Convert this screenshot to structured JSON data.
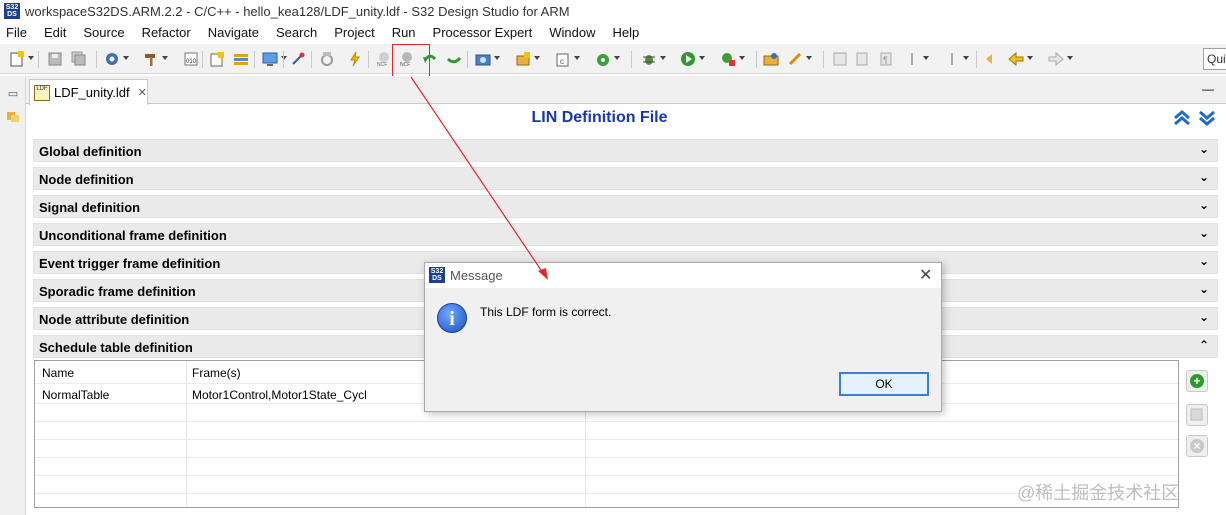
{
  "window": {
    "title": "workspaceS32DS.ARM.2.2 - C/C++ - hello_kea128/LDF_unity.ldf - S32 Design Studio for ARM",
    "app_icon_text_1": "S32",
    "app_icon_text_2": "DS"
  },
  "menu": [
    "File",
    "Edit",
    "Source",
    "Refactor",
    "Navigate",
    "Search",
    "Project",
    "Run",
    "Processor Expert",
    "Window",
    "Help"
  ],
  "toolbar": {
    "quick_access_text": "Qui"
  },
  "editor_tab": {
    "label": "LDF_unity.ldf",
    "icon_text": "LDF",
    "close_glyph": "✕"
  },
  "content": {
    "title": "LIN Definition File",
    "sections": [
      {
        "label": "Global definition",
        "toggle": "⌄"
      },
      {
        "label": "Node definition",
        "toggle": "⌄"
      },
      {
        "label": "Signal definition",
        "toggle": "⌄"
      },
      {
        "label": "Unconditional frame definition",
        "toggle": "⌄"
      },
      {
        "label": "Event trigger frame definition",
        "toggle": "⌄"
      },
      {
        "label": "Sporadic frame definition",
        "toggle": "⌄"
      },
      {
        "label": "Node attribute definition",
        "toggle": "⌄"
      },
      {
        "label": "Schedule table definition",
        "toggle": "⌃"
      }
    ],
    "schedule_table": {
      "columns": [
        "Name",
        "Frame(s)"
      ],
      "rows": [
        {
          "name": "NormalTable",
          "frames": "Motor1Control,Motor1State_Cycl"
        }
      ]
    }
  },
  "dialog": {
    "title": "Message",
    "message": "This LDF form is correct.",
    "ok_label": "OK",
    "close_glyph": "✕",
    "info_glyph": "i"
  },
  "watermark": "@稀土掘金技术社区",
  "colors": {
    "title_blue": "#1638b8",
    "annotation_red": "#e0282c",
    "section_bg": "#eaeaea"
  }
}
